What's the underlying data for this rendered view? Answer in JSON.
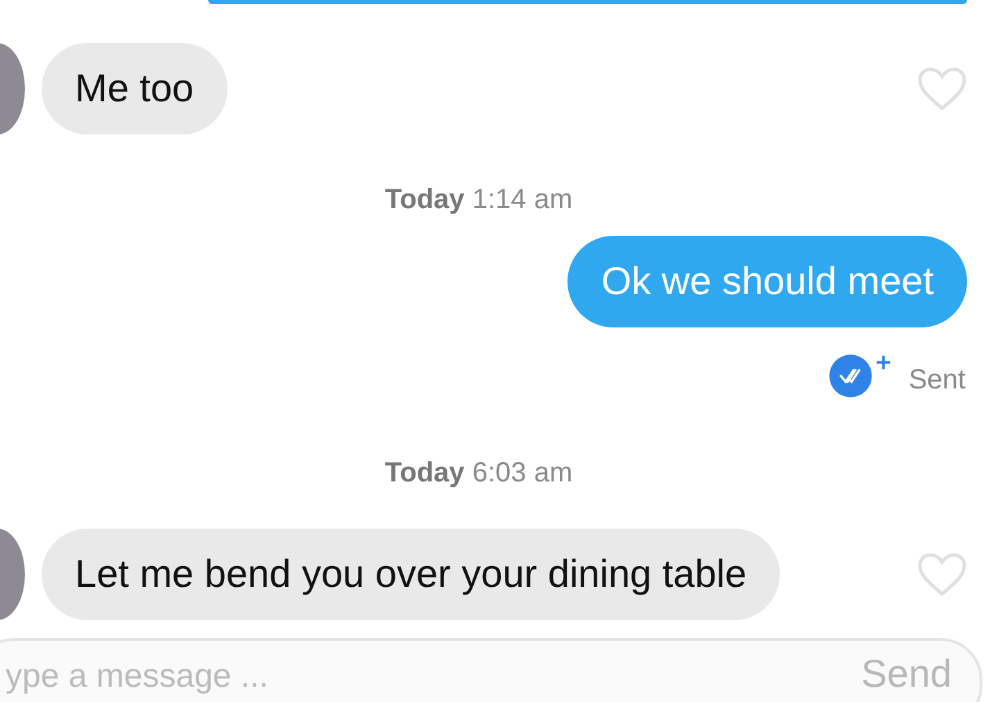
{
  "messages": [
    {
      "kind": "incoming",
      "text": "Me too",
      "liked": false
    },
    {
      "kind": "timestamp",
      "text": "**Today** 1:14 am"
    },
    {
      "kind": "outgoing",
      "text": "Ok we should meet",
      "status": "Sent"
    },
    {
      "kind": "timestamp",
      "text": "**Today** 6:03 am"
    },
    {
      "kind": "incoming",
      "text": "Let me bend you over your dining table",
      "liked": false
    }
  ],
  "composer": {
    "placeholder": "ype a message ...",
    "send": "Send"
  }
}
